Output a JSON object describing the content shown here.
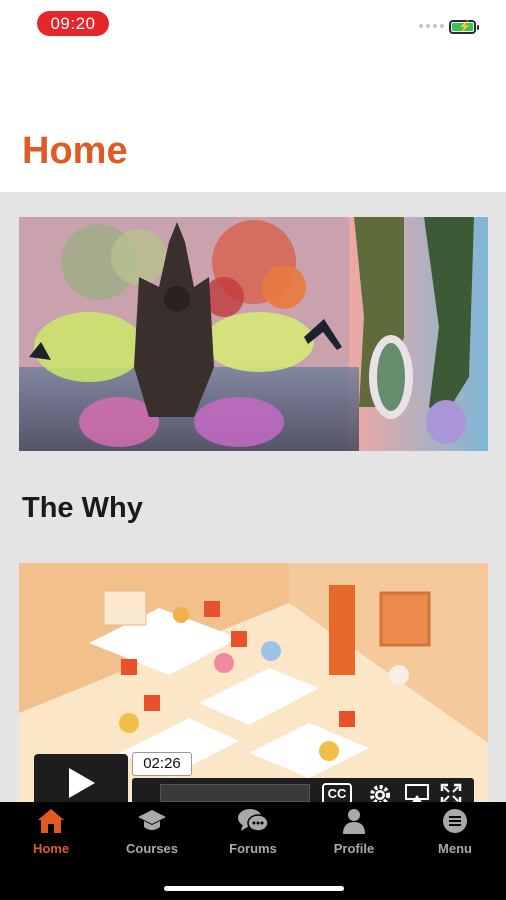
{
  "status_bar": {
    "time": "09:20",
    "battery_color": "#34c759",
    "time_pill_color": "#e5262b"
  },
  "header": {
    "title": "Home",
    "accent_color": "#e05a26"
  },
  "content": {
    "section_title": "The Why",
    "video": {
      "time_tooltip": "02:26",
      "cc_label": "CC",
      "play_icon": "play-icon"
    }
  },
  "tabs": [
    {
      "label": "Home",
      "icon": "home-icon",
      "active": true
    },
    {
      "label": "Courses",
      "icon": "graduation-cap-icon",
      "active": false
    },
    {
      "label": "Forums",
      "icon": "chat-bubbles-icon",
      "active": false
    },
    {
      "label": "Profile",
      "icon": "person-icon",
      "active": false
    },
    {
      "label": "Menu",
      "icon": "menu-icon",
      "active": false
    }
  ]
}
